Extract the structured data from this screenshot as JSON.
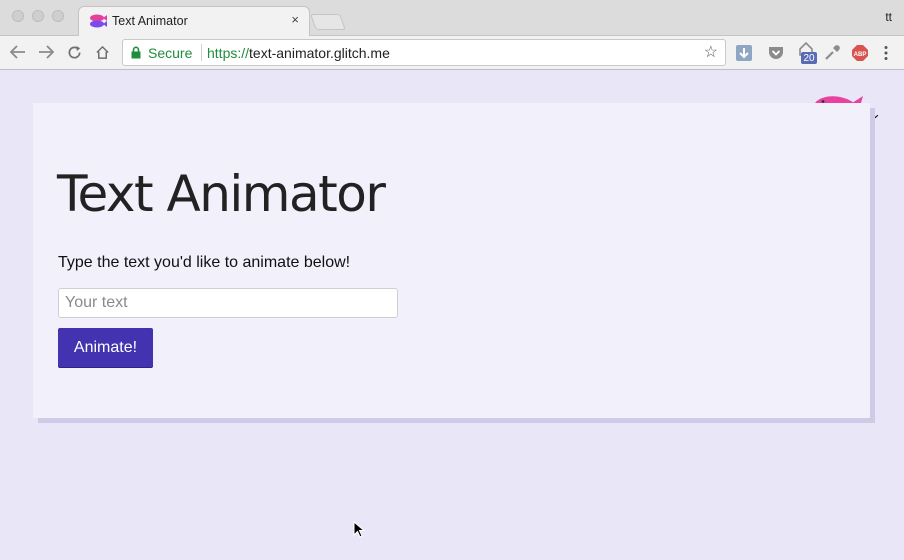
{
  "browser": {
    "tab_title": "Text Animator",
    "tab_close": "×",
    "profile": "tt",
    "secure_label": "Secure",
    "url_scheme": "https://",
    "url_host": "text-animator.glitch.me",
    "extension_badge": "20",
    "nav_icons": [
      "back-icon",
      "forward-icon",
      "reload-icon",
      "home-icon"
    ],
    "extension_icons": [
      "download-icon",
      "pocket-icon",
      "mail-badge-icon",
      "eyedropper-icon",
      "adblock-icon",
      "menu-icon"
    ]
  },
  "page": {
    "title": "Text Animator",
    "prompt": "Type the text you'd like to animate below!",
    "input_placeholder": "Your text",
    "input_value": "",
    "button_label": "Animate!"
  },
  "colors": {
    "accent": "#4433b0",
    "background": "#e9e6f7",
    "card": "#f1f0fb",
    "secure_green": "#1e8e3e"
  }
}
